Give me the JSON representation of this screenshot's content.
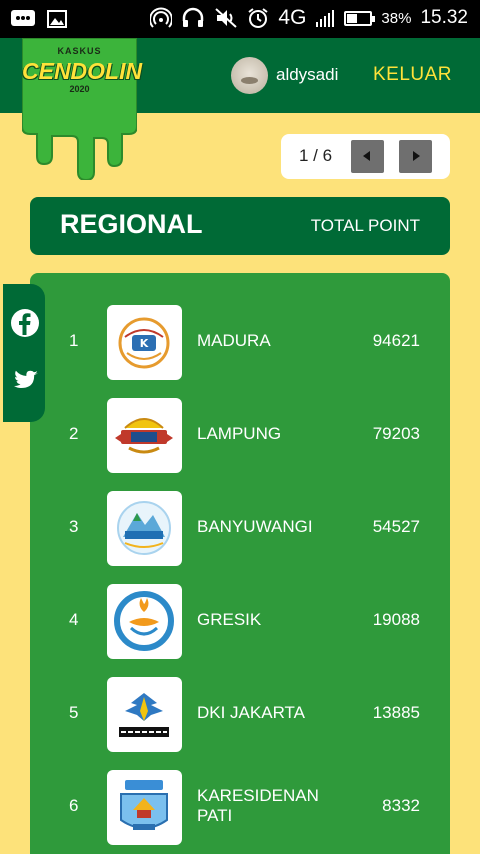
{
  "status_bar": {
    "network": "4G",
    "battery": "38%",
    "battery_level": 0.38,
    "time": "15.32",
    "icons": [
      "chat-icon",
      "image-icon",
      "hotspot-icon",
      "headset-icon",
      "mute-icon",
      "alarm-icon",
      "signal-icon",
      "battery-icon"
    ]
  },
  "header": {
    "logo": {
      "brand": "KASKUS",
      "name": "CENDOLIN",
      "year": "2020"
    },
    "username": "aldysadi",
    "logout_label": "KELUAR",
    "colors": {
      "header": "#006a36",
      "accent": "#ffe23a"
    }
  },
  "pager": {
    "label": "1 / 6"
  },
  "section": {
    "title": "REGIONAL",
    "column_label": "TOTAL POINT"
  },
  "rows": [
    {
      "rank": "1",
      "region": "MADURA",
      "points": "94621",
      "emblem": "madura-emblem"
    },
    {
      "rank": "2",
      "region": "LAMPUNG",
      "points": "79203",
      "emblem": "lampung-emblem"
    },
    {
      "rank": "3",
      "region": "BANYUWANGI",
      "points": "54527",
      "emblem": "banyuwangi-emblem"
    },
    {
      "rank": "4",
      "region": "GRESIK",
      "points": "19088",
      "emblem": "gresik-emblem"
    },
    {
      "rank": "5",
      "region": "DKI JAKARTA",
      "points": "13885",
      "emblem": "jakarta-emblem"
    },
    {
      "rank": "6",
      "region": "KARESIDENAN PATI",
      "points": "8332",
      "emblem": "pati-emblem"
    }
  ],
  "social": [
    "facebook-icon",
    "twitter-icon"
  ]
}
